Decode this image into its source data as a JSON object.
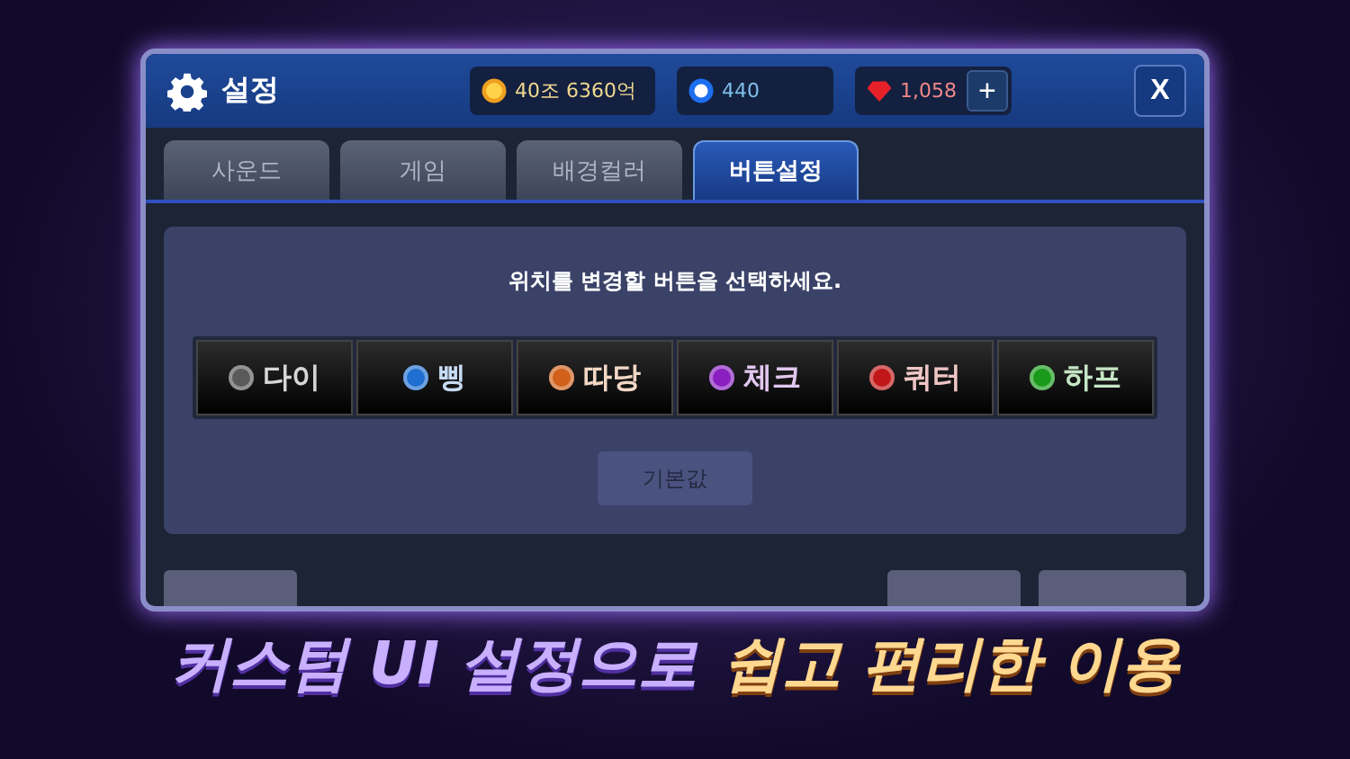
{
  "window": {
    "title": "설정"
  },
  "currencies": [
    {
      "kind": "gold",
      "value": "40조 6360억"
    },
    {
      "kind": "chip",
      "value": "440"
    },
    {
      "kind": "gem",
      "value": "1,058"
    }
  ],
  "add_button": "+",
  "close_button": "X",
  "tabs": [
    {
      "label": "사운드",
      "selected": false
    },
    {
      "label": "게임",
      "selected": false
    },
    {
      "label": "배경컬러",
      "selected": false
    },
    {
      "label": "버튼설정",
      "selected": true
    }
  ],
  "instruction": "위치를 변경할 버튼을 선택하세요.",
  "action_buttons": [
    {
      "label": "다이",
      "color": "#5a5a5a"
    },
    {
      "label": "삥",
      "color": "#1f6fd0"
    },
    {
      "label": "따당",
      "color": "#d0601a"
    },
    {
      "label": "체크",
      "color": "#8a1fc0"
    },
    {
      "label": "쿼터",
      "color": "#c01818"
    },
    {
      "label": "하프",
      "color": "#1a9a1a"
    }
  ],
  "reset_button": "기본값",
  "caption": {
    "lead": "커스텀 UI 설정으로",
    "highlight": "쉽고 편리한 이용"
  }
}
